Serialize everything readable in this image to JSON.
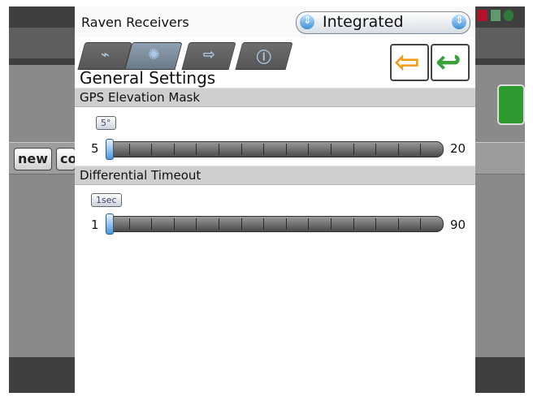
{
  "background": {
    "buttons": [
      {
        "label": "new"
      },
      {
        "label": "co"
      }
    ],
    "accent_green": "#2f9a2f"
  },
  "dialog": {
    "title": "Raven Receivers",
    "mode_select": {
      "value": "Integrated"
    },
    "tabs": [
      {
        "name": "tab-1",
        "icon": "antenna-icon"
      },
      {
        "name": "tab-2",
        "icon": "satellite-icon",
        "active": true
      },
      {
        "name": "tab-3",
        "icon": "arrow-right-icon"
      },
      {
        "name": "tab-4",
        "icon": "info-icon"
      }
    ],
    "back_icon": "orange-left-arrow-icon",
    "ok_icon": "green-return-arrow-icon",
    "heading": "General Settings",
    "settings": [
      {
        "title": "GPS Elevation Mask",
        "min": "5",
        "max": "20",
        "value": 5,
        "tip": "5°",
        "color": "#4b95d8"
      },
      {
        "title": "Differential Timeout",
        "min": "1",
        "max": "90",
        "value": 1,
        "tip": "1sec",
        "color": "#4b95d8"
      }
    ]
  }
}
